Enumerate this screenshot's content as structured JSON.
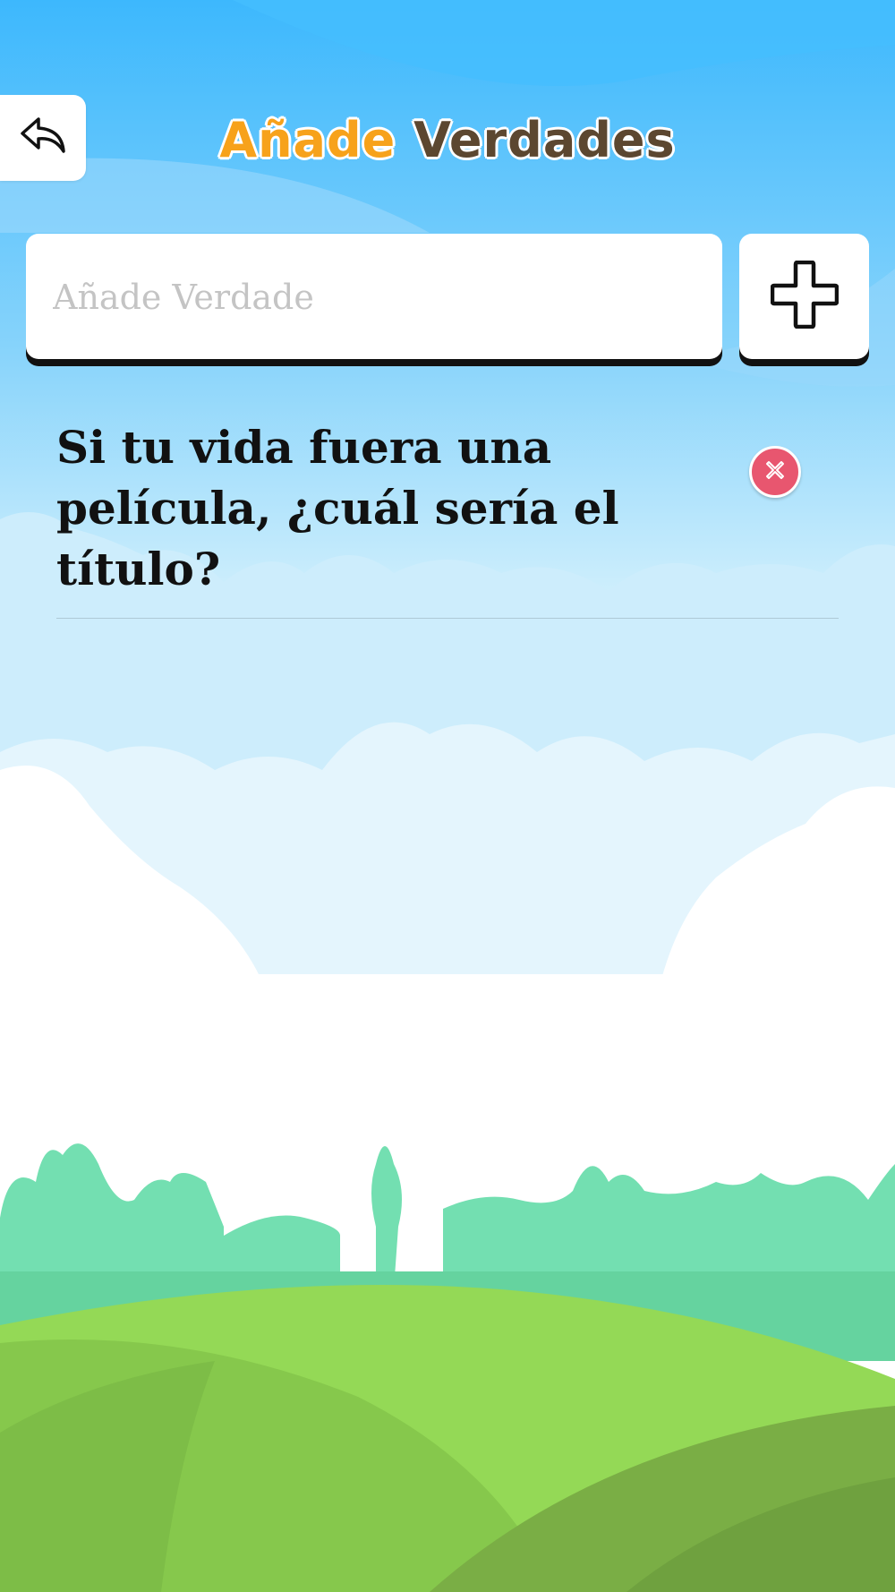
{
  "header": {
    "title_part1": "Añade",
    "title_part2": "Verdades",
    "back_icon": "reply-arrow-icon"
  },
  "input": {
    "placeholder": "Añade Verdade",
    "value": "",
    "add_icon": "plus-icon"
  },
  "items": [
    {
      "text": "Si tu vida fuera una película, ¿cuál sería el título?",
      "delete_icon": "close-circle-icon"
    }
  ],
  "colors": {
    "title_orange": "#f7a21b",
    "title_brown": "#5c4730",
    "sky": "#3bbaff",
    "delete_red": "#e8566f",
    "grass": "#8fd454"
  }
}
